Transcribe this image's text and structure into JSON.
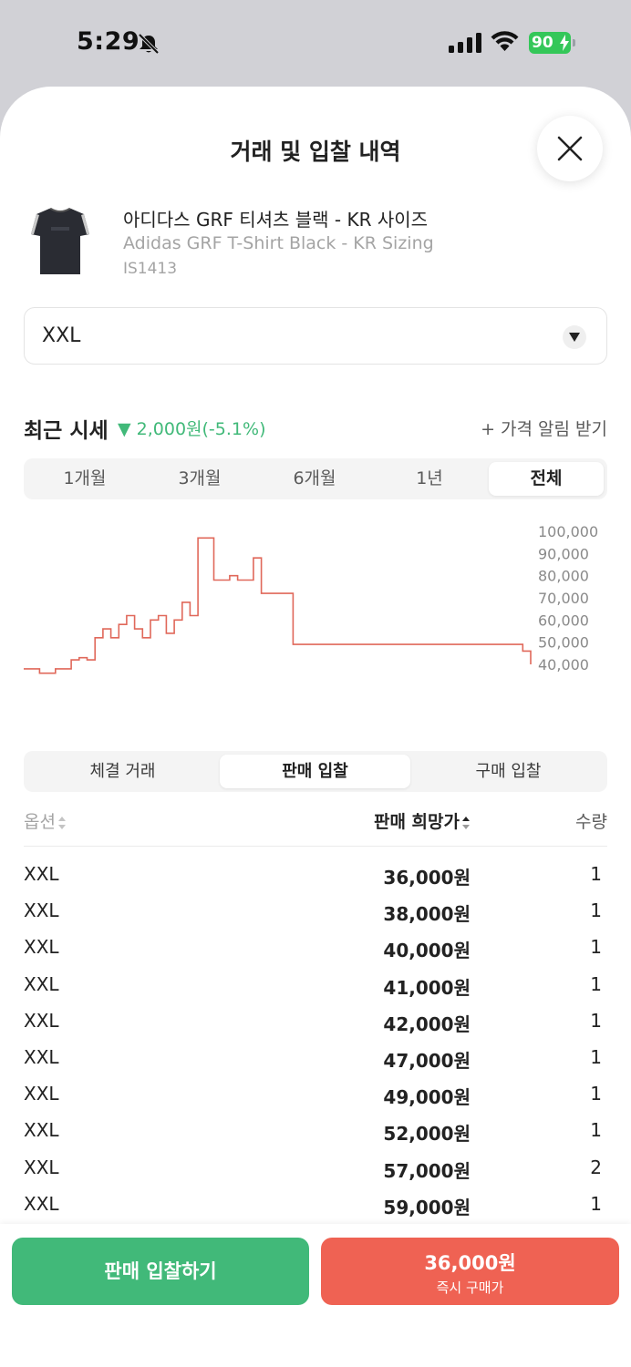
{
  "status_bar": {
    "time": "5:29",
    "battery": "90"
  },
  "sheet": {
    "title": "거래 및 입찰 내역"
  },
  "product": {
    "name_ko": "아디다스 GRF 티셔츠 블랙 - KR 사이즈",
    "name_en": "Adidas GRF T-Shirt Black - KR Sizing",
    "code": "IS1413"
  },
  "size_select": {
    "value": "XXL"
  },
  "price_section": {
    "title": "최근 시세",
    "change": "▼ 2,000원(-5.1%)",
    "alert": "+ 가격 알림 받기"
  },
  "period_tabs": [
    {
      "label": "1개월",
      "active": false
    },
    {
      "label": "3개월",
      "active": false
    },
    {
      "label": "6개월",
      "active": false
    },
    {
      "label": "1년",
      "active": false
    },
    {
      "label": "전체",
      "active": true
    }
  ],
  "chart_data": {
    "type": "line",
    "ylim": [
      40000,
      100000
    ],
    "y_ticks": [
      "100,000",
      "90,000",
      "80,000",
      "70,000",
      "60,000",
      "50,000",
      "40,000"
    ],
    "series": [
      {
        "color": "#e0685a",
        "values": [
          38000,
          38000,
          36000,
          36000,
          38000,
          38000,
          42000,
          43000,
          42000,
          52000,
          56000,
          52000,
          58000,
          62000,
          56000,
          52000,
          60000,
          62000,
          54000,
          60000,
          68000,
          62000,
          97000,
          97000,
          78000,
          78000,
          80000,
          78000,
          78000,
          88000,
          72000,
          72000,
          72000,
          72000,
          49000,
          49000,
          49000,
          49000,
          49000,
          49000,
          49000,
          49000,
          49000,
          49000,
          49000,
          49000,
          49000,
          49000,
          49000,
          49000,
          49000,
          49000,
          49000,
          49000,
          49000,
          49000,
          49000,
          49000,
          49000,
          49000,
          49000,
          49000,
          49000,
          46000,
          40000
        ]
      }
    ]
  },
  "bid_tabs": [
    {
      "label": "체결 거래",
      "active": false
    },
    {
      "label": "판매 입찰",
      "active": true
    },
    {
      "label": "구매 입찰",
      "active": false
    }
  ],
  "table": {
    "headers": {
      "option": "옵션",
      "price": "판매 희망가",
      "qty": "수량"
    },
    "rows": [
      {
        "option": "XXL",
        "price": "36,000원",
        "qty": "1"
      },
      {
        "option": "XXL",
        "price": "38,000원",
        "qty": "1"
      },
      {
        "option": "XXL",
        "price": "40,000원",
        "qty": "1"
      },
      {
        "option": "XXL",
        "price": "41,000원",
        "qty": "1"
      },
      {
        "option": "XXL",
        "price": "42,000원",
        "qty": "1"
      },
      {
        "option": "XXL",
        "price": "47,000원",
        "qty": "1"
      },
      {
        "option": "XXL",
        "price": "49,000원",
        "qty": "1"
      },
      {
        "option": "XXL",
        "price": "52,000원",
        "qty": "1"
      },
      {
        "option": "XXL",
        "price": "57,000원",
        "qty": "2"
      },
      {
        "option": "XXL",
        "price": "59,000원",
        "qty": "1"
      }
    ]
  },
  "bottom_bar": {
    "sell_label": "판매 입찰하기",
    "buy_price": "36,000원",
    "buy_sub": "즉시 구매가"
  },
  "colors": {
    "green": "#41b979",
    "red": "#ef6253",
    "chart_line": "#e0685a"
  }
}
